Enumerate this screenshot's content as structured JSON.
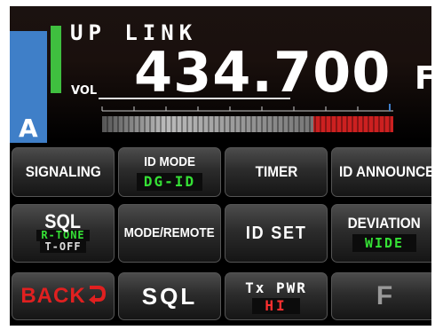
{
  "display": {
    "mode_label": "UP LINK",
    "vol_label": "VOL",
    "frequency": "434.700",
    "modulation": "FM",
    "band_indicator": "A"
  },
  "buttons": {
    "signaling": {
      "label": "SIGNALING"
    },
    "id_mode": {
      "label": "ID MODE",
      "value": "DG-ID"
    },
    "timer": {
      "label": "TIMER"
    },
    "id_announce": {
      "label": "ID ANNOUNCE"
    },
    "sql": {
      "label": "SQL",
      "value1": "R-TONE",
      "value2": "T-OFF"
    },
    "mode_remote": {
      "label": "MODE/REMOTE"
    },
    "id_set": {
      "label": "ID SET"
    },
    "deviation": {
      "label": "DEVIATION",
      "value": "WIDE"
    },
    "back": {
      "label": "BACK",
      "icon": "return-arrow-icon"
    },
    "sql_key": {
      "label": "SQL"
    },
    "tx_pwr": {
      "label": "Tx PWR",
      "value": "HI"
    },
    "f_key": {
      "label": "F"
    }
  },
  "colors": {
    "accent_green": "#35e035",
    "power_red": "#ff3030",
    "band_blue": "#3f7fc8"
  }
}
